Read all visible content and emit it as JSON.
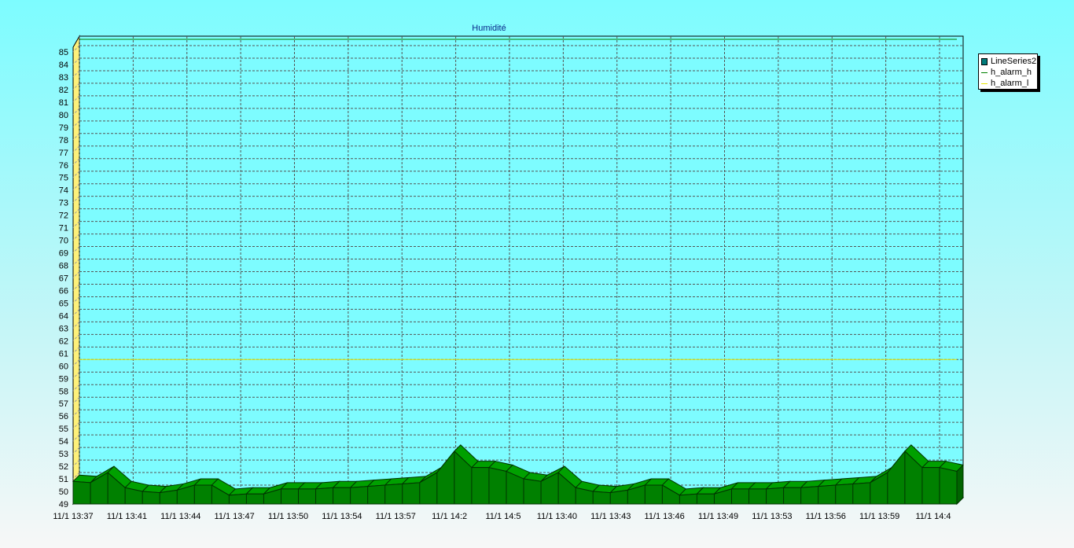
{
  "chart_data": {
    "type": "area",
    "title": "Humidité",
    "ylim": [
      49,
      85
    ],
    "y_ticks": [
      49,
      50,
      51,
      52,
      53,
      54,
      55,
      56,
      57,
      58,
      59,
      60,
      61,
      62,
      63,
      64,
      65,
      66,
      67,
      68,
      69,
      70,
      71,
      72,
      73,
      74,
      75,
      76,
      77,
      78,
      79,
      80,
      81,
      82,
      83,
      84,
      85
    ],
    "x_tick_labels": [
      "11/1  13:37",
      "11/1  13:41",
      "11/1  13:44",
      "11/1  13:47",
      "11/1  13:50",
      "11/1  13:54",
      "11/1  13:57",
      "11/1  14:2",
      "11/1  14:5",
      "11/1  13:40",
      "11/1  13:43",
      "11/1  13:46",
      "11/1  13:49",
      "11/1  13:53",
      "11/1  13:56",
      "11/1  13:59",
      "11/1  14:4"
    ],
    "grid": true,
    "view_3d": true,
    "legend_position": "top-right",
    "series": [
      {
        "name": "LineSeries2",
        "style": "3d-area",
        "color": "#008000",
        "values": [
          50.8,
          50.7,
          51.5,
          50.3,
          50.0,
          49.9,
          50.1,
          50.5,
          50.5,
          49.7,
          49.8,
          49.8,
          50.2,
          50.2,
          50.2,
          50.3,
          50.3,
          50.4,
          50.5,
          50.6,
          50.7,
          51.5,
          53.2,
          51.9,
          51.9,
          51.6,
          51.0,
          50.8,
          51.5,
          50.3,
          50.0,
          49.9,
          50.1,
          50.5,
          50.5,
          49.7,
          49.8,
          49.8,
          50.2,
          50.2,
          50.2,
          50.3,
          50.3,
          50.4,
          50.5,
          50.6,
          50.7,
          51.5,
          53.2,
          51.9,
          51.9,
          51.6
        ]
      },
      {
        "name": "h_alarm_h",
        "style": "line",
        "color": "#008000",
        "value": 85.5
      },
      {
        "name": "h_alarm_l",
        "style": "line",
        "color": "#e6e600",
        "value": 60
      }
    ],
    "colors": {
      "area_fill": "#008000",
      "area_stroke": "#003300",
      "left_wall": "#fdf07a",
      "plot_background": "#7dfcff"
    }
  },
  "legend": {
    "items": [
      {
        "label": "LineSeries2",
        "type": "box",
        "color": "#007b7b"
      },
      {
        "label": "h_alarm_h",
        "type": "line",
        "color": "#008000"
      },
      {
        "label": "h_alarm_l",
        "type": "line",
        "color": "#e6e600"
      }
    ]
  }
}
